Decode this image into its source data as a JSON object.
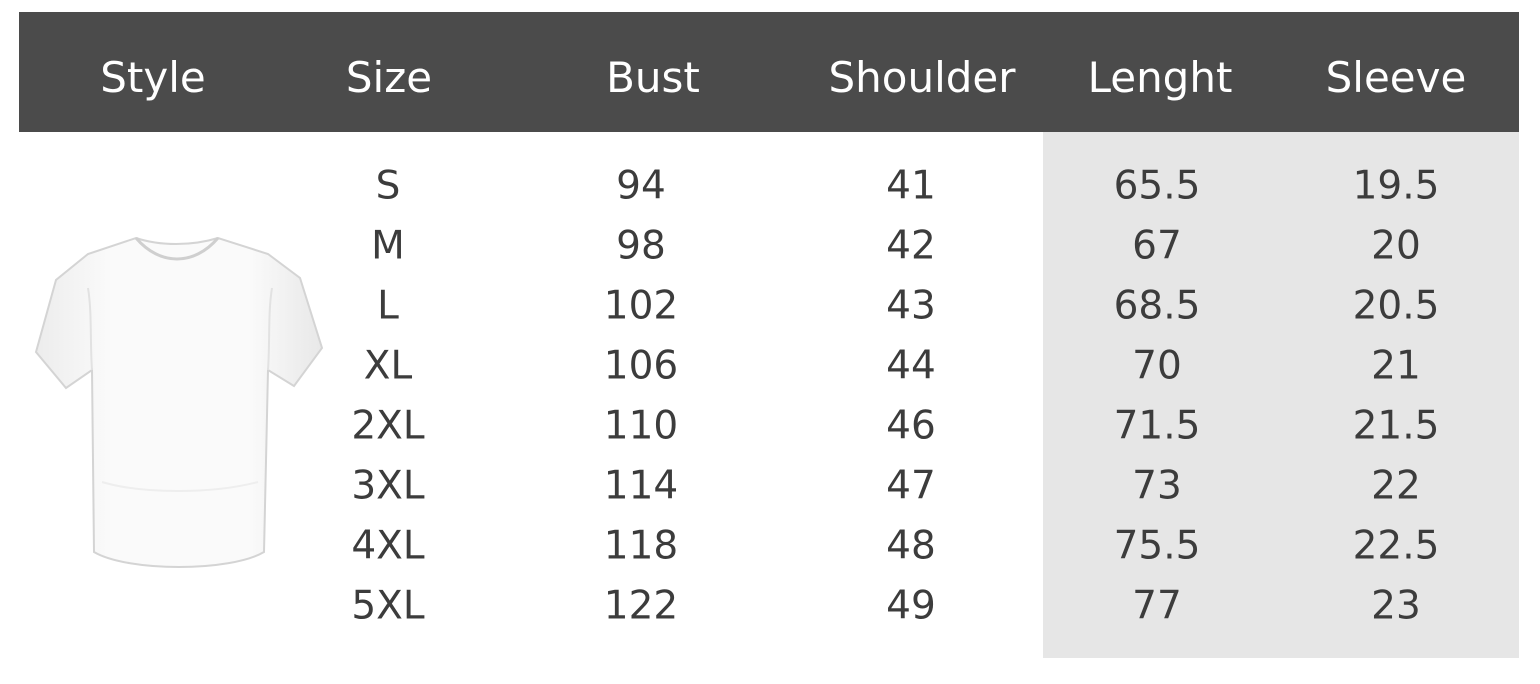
{
  "headers": [
    "Style",
    "Size",
    "Bust",
    "Shoulder",
    "Lenght",
    "Sleeve"
  ],
  "style_image": "white-tshirt",
  "colors": {
    "header_bg": "#4b4b4b",
    "header_text": "#ffffff",
    "shade_bg": "#e6e6e6",
    "cell_text": "#3c3c3c"
  },
  "columns": {
    "size": [
      "S",
      "M",
      "L",
      "XL",
      "2XL",
      "3XL",
      "4XL",
      "5XL"
    ],
    "bust": [
      "94",
      "98",
      "102",
      "106",
      "110",
      "114",
      "118",
      "122"
    ],
    "shoulder": [
      "41",
      "42",
      "43",
      "44",
      "46",
      "47",
      "48",
      "49"
    ],
    "length": [
      "65.5",
      "67",
      "68.5",
      "70",
      "71.5",
      "73",
      "75.5",
      "77"
    ],
    "sleeve": [
      "19.5",
      "20",
      "20.5",
      "21",
      "21.5",
      "22",
      "22.5",
      "23"
    ]
  }
}
